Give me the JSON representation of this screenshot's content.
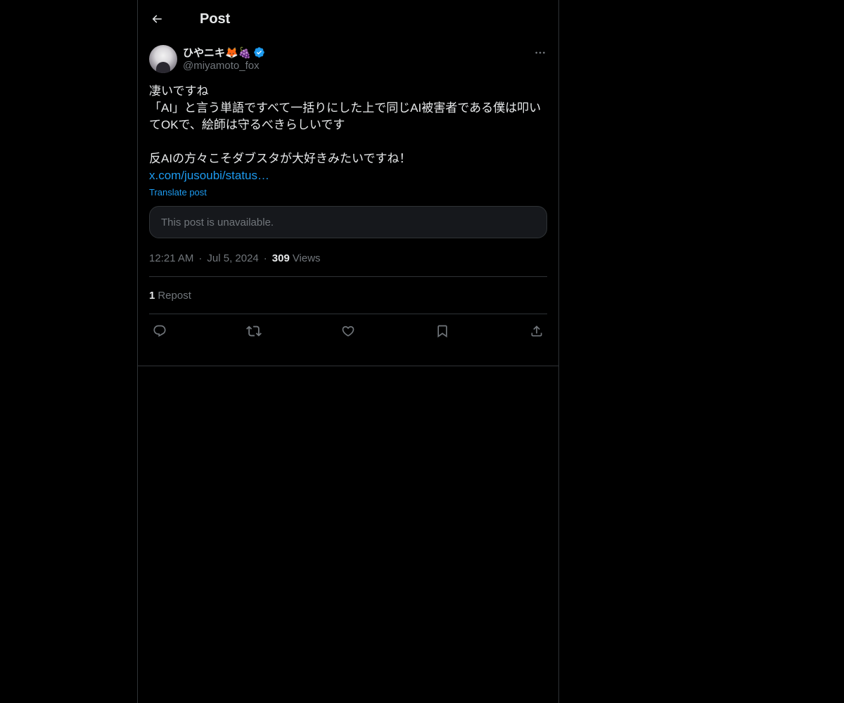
{
  "header": {
    "title": "Post",
    "back_icon": "arrow-left-icon"
  },
  "post": {
    "author": {
      "display_name": "ひやニキ🦊🍇",
      "handle": "@miyamoto_fox",
      "verified": true,
      "verified_color": "#1d9bf0"
    },
    "more_icon": "more-horizontal-icon",
    "text": "凄いですね\n「AI」と言う単語ですべて一括りにした上で同じAI被害者である僕は叩いてOKで、絵師は守るべきらしいです\n\n反AIの方々こそダブスタが大好きみたいですね！\n",
    "link": "x.com/jusoubi/status…",
    "translate_label": "Translate post",
    "quoted_unavailable": "This post is unavailable.",
    "time": "12:21 AM",
    "date": "Jul 5, 2024",
    "views_count": "309",
    "views_label": "Views",
    "meta_separator": "·"
  },
  "stats": {
    "reposts_count": "1",
    "reposts_label": "Repost"
  },
  "actions": [
    {
      "name": "reply",
      "icon": "reply-icon"
    },
    {
      "name": "repost",
      "icon": "repost-icon"
    },
    {
      "name": "like",
      "icon": "heart-icon"
    },
    {
      "name": "bookmark",
      "icon": "bookmark-icon"
    },
    {
      "name": "share",
      "icon": "share-icon"
    }
  ],
  "colors": {
    "background": "#000000",
    "text": "#e7e9ea",
    "muted": "#71767b",
    "accent": "#1d9bf0",
    "border": "#2f3336"
  }
}
